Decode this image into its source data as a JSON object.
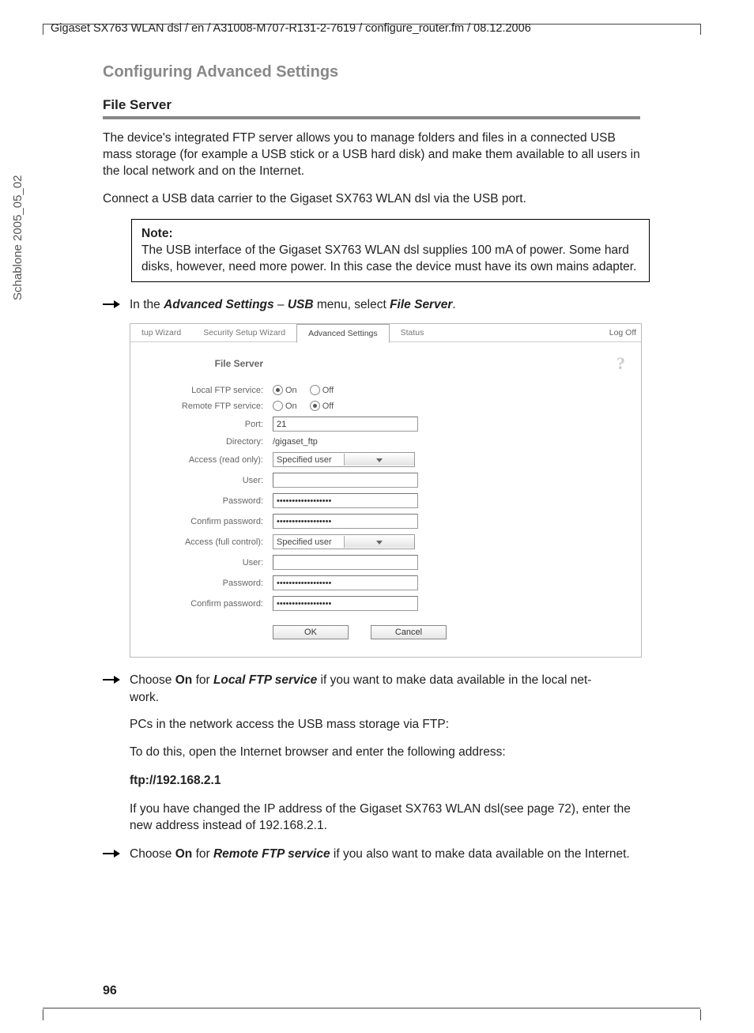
{
  "header_path": "Gigaset SX763 WLAN dsl / en / A31008-M707-R131-2-7619 / configure_router.fm / 08.12.2006",
  "side_text": "Schablone 2005_05_02",
  "section_title": "Configuring Advanced Settings",
  "subsection_title": "File Server",
  "para1": "The device's integrated FTP server allows you to manage folders and files in a connected USB mass storage (for example a USB stick or a USB hard disk) and make them available to all users in the local network and on the Internet.",
  "para2": "Connect a USB data carrier to the Gigaset SX763 WLAN dsl via the USB port.",
  "note": {
    "label": "Note:",
    "text": "The USB interface of the Gigaset SX763 WLAN dsl supplies 100 mA of power. Some hard disks, however, need more power. In this case the device must have its own mains adapter."
  },
  "step1": {
    "pre": "In the ",
    "b1": "Advanced Settings",
    "mid": " – ",
    "b2": "USB",
    "mid2": " menu, select ",
    "b3": "File Server",
    "post": "."
  },
  "ui": {
    "tabs": {
      "t1": "tup Wizard",
      "t2": "Security Setup Wizard",
      "t3": "Advanced Settings",
      "t4": "Status"
    },
    "logoff": "Log Off",
    "title": "File Server",
    "labels": {
      "local_ftp": "Local FTP service:",
      "remote_ftp": "Remote FTP service:",
      "port": "Port:",
      "directory": "Directory:",
      "access_ro": "Access (read only):",
      "user": "User:",
      "password": "Password:",
      "confirm": "Confirm password:",
      "access_fc": "Access (full control):"
    },
    "on": "On",
    "off": "Off",
    "port_value": "21",
    "dir_value": "/gigaset_ftp",
    "select_value": "Specified user",
    "pw_mask": "••••••••••••••••••",
    "ok": "OK",
    "cancel": "Cancel"
  },
  "step2": {
    "pre": "Choose ",
    "b1": "On",
    "mid": " for ",
    "b2": "Local FTP service",
    "post": " if you want to make data available in the local net",
    "post2": "work."
  },
  "para3": "PCs in the network access the USB mass storage via FTP:",
  "para4": "To do this, open the Internet browser and enter the following address:",
  "ftp_url": "ftp://192.168.2.1",
  "para5": "If you have changed the IP address of the Gigaset SX763 WLAN dsl(see page 72), enter the new address instead of 192.168.2.1.",
  "step3": {
    "pre": "Choose ",
    "b1": "On",
    "mid": " for ",
    "b2": "Remote FTP service",
    "post": " if you also want to make data available on the Internet."
  },
  "page_number": "96"
}
